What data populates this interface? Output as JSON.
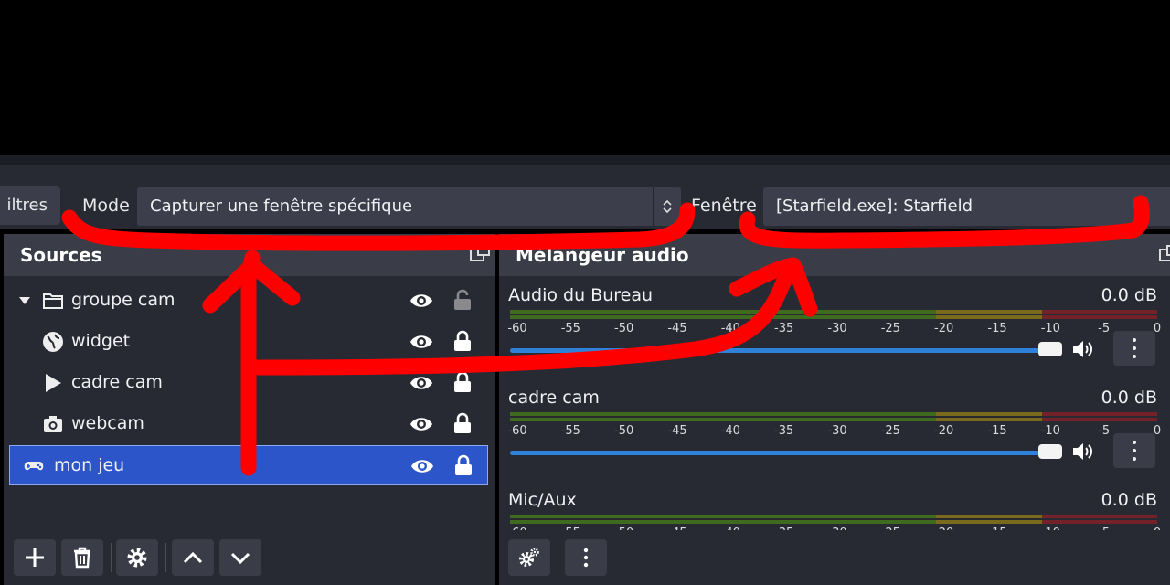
{
  "props": {
    "filters_label": "iltres",
    "mode_label": "Mode",
    "mode_value": "Capturer une fenêtre spécifique",
    "window_label": "Fenêtre",
    "window_value": "[Starfield.exe]: Starfield"
  },
  "sources_dock": {
    "title": "Sources",
    "items": [
      {
        "name": "groupe cam",
        "icon": "folder-icon",
        "locked": false
      },
      {
        "name": "widget",
        "icon": "globe-icon",
        "locked": true
      },
      {
        "name": "cadre cam",
        "icon": "play-icon",
        "locked": true
      },
      {
        "name": "webcam",
        "icon": "camera-icon",
        "locked": true
      },
      {
        "name": "mon jeu",
        "icon": "gamepad-icon",
        "locked": true,
        "selected": true
      }
    ]
  },
  "mixer_dock": {
    "title": "Mélangeur audio",
    "ticks": [
      "-60",
      "-55",
      "-50",
      "-45",
      "-40",
      "-35",
      "-30",
      "-25",
      "-20",
      "-15",
      "-10",
      "-5",
      "0"
    ],
    "channels": [
      {
        "name": "Audio du Bureau",
        "db": "0.0 dB"
      },
      {
        "name": "cadre cam",
        "db": "0.0 dB"
      },
      {
        "name": "Mic/Aux",
        "db": "0.0 dB"
      }
    ]
  },
  "colors": {
    "accent_selection": "#2c55c9",
    "slider": "#2f82d9",
    "annotation": "#ff0000"
  }
}
